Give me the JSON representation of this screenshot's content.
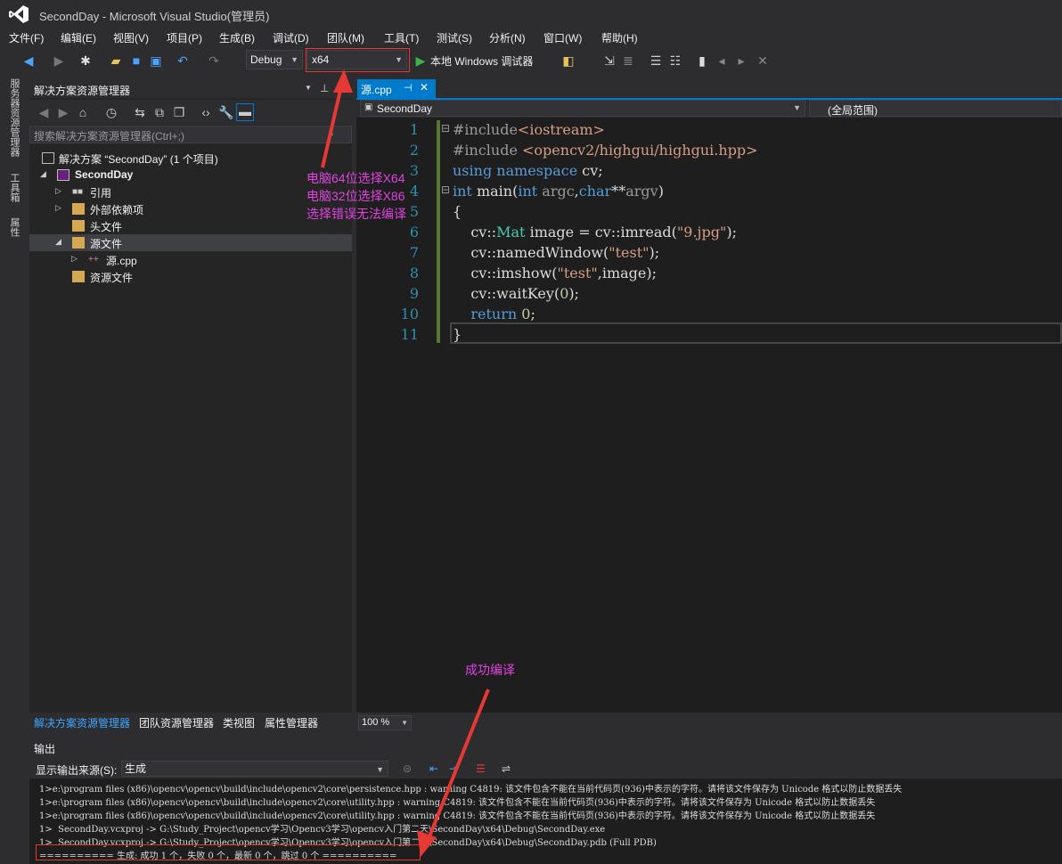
{
  "window": {
    "title": "SecondDay - Microsoft Visual Studio(管理员)"
  },
  "menu": [
    "文件(F)",
    "编辑(E)",
    "视图(V)",
    "项目(P)",
    "生成(B)",
    "调试(D)",
    "团队(M)",
    "工具(T)",
    "测试(S)",
    "分析(N)",
    "窗口(W)",
    "帮助(H)"
  ],
  "toolbar": {
    "config": "Debug",
    "platform": "x64",
    "debugger": "本地 Windows 调试器"
  },
  "left_strip": [
    "服务器资源管理器",
    "工具箱",
    "属性"
  ],
  "solution_explorer": {
    "title": "解决方案资源管理器",
    "search_placeholder": "搜索解决方案资源管理器(Ctrl+;)",
    "tree": [
      {
        "label": "解决方案 “SecondDay” (1 个项目)"
      },
      {
        "label": "SecondDay"
      },
      {
        "label": "引用"
      },
      {
        "label": "外部依赖项"
      },
      {
        "label": "头文件"
      },
      {
        "label": "源文件"
      },
      {
        "label": "源.cpp"
      },
      {
        "label": "资源文件"
      }
    ],
    "bottom_tabs": [
      "解决方案资源管理器",
      "团队资源管理器",
      "类视图",
      "属性管理器"
    ]
  },
  "editor": {
    "tab_label": "源.cpp",
    "nav_left": "SecondDay",
    "nav_right": "(全局范围)",
    "zoom": "100 %",
    "line_numbers": [
      "1",
      "2",
      "3",
      "4",
      "5",
      "6",
      "7",
      "8",
      "9",
      "10",
      "11"
    ]
  },
  "output": {
    "title": "输出",
    "source_label": "显示输出来源(S):",
    "source_value": "生成",
    "lines": [
      "1>e:\\program files (x86)\\opencv\\opencv\\build\\include\\opencv2\\core\\persistence.hpp : warning C4819: 该文件包含不能在当前代码页(936)中表示的字符。请将该文件保存为 Unicode 格式以防止数据丢失",
      "1>e:\\program files (x86)\\opencv\\opencv\\build\\include\\opencv2\\core\\utility.hpp : warning C4819: 该文件包含不能在当前代码页(936)中表示的字符。请将该文件保存为 Unicode 格式以防止数据丢失",
      "1>e:\\program files (x86)\\opencv\\opencv\\build\\include\\opencv2\\core\\utility.hpp : warning C4819: 该文件包含不能在当前代码页(936)中表示的字符。请将该文件保存为 Unicode 格式以防止数据丢失",
      "1>  SecondDay.vcxproj -> G:\\Study_Project\\opencv学习\\Opencv3学习\\opencv入门第二天\\SecondDay\\x64\\Debug\\SecondDay.exe",
      "1>  SecondDay.vcxproj -> G:\\Study_Project\\opencv学习\\Opencv3学习\\opencv入门第二天\\SecondDay\\x64\\Debug\\SecondDay.pdb (Full PDB)",
      "========== 生成: 成功 1 个，失败 0 个，最新 0 个，跳过 0 个 =========="
    ]
  },
  "annotations": {
    "note1": "电脑64位选择X64",
    "note2": "电脑32位选择X86",
    "note3": "选择错误无法编译",
    "note4": "成功编译"
  },
  "colors": {
    "accent": "#007acc",
    "annotation": "#e043e0",
    "highlight_box": "#e53935"
  }
}
